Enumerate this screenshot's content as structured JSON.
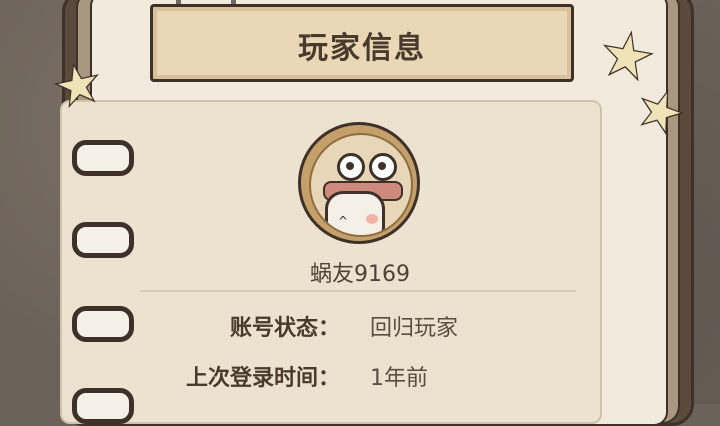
{
  "panel": {
    "title": "玩家信息",
    "username": "蜗友9169",
    "rows": [
      {
        "label": "账号状态：",
        "value": "回归玩家"
      },
      {
        "label": "上次登录时间：",
        "value": "1年前"
      }
    ]
  }
}
